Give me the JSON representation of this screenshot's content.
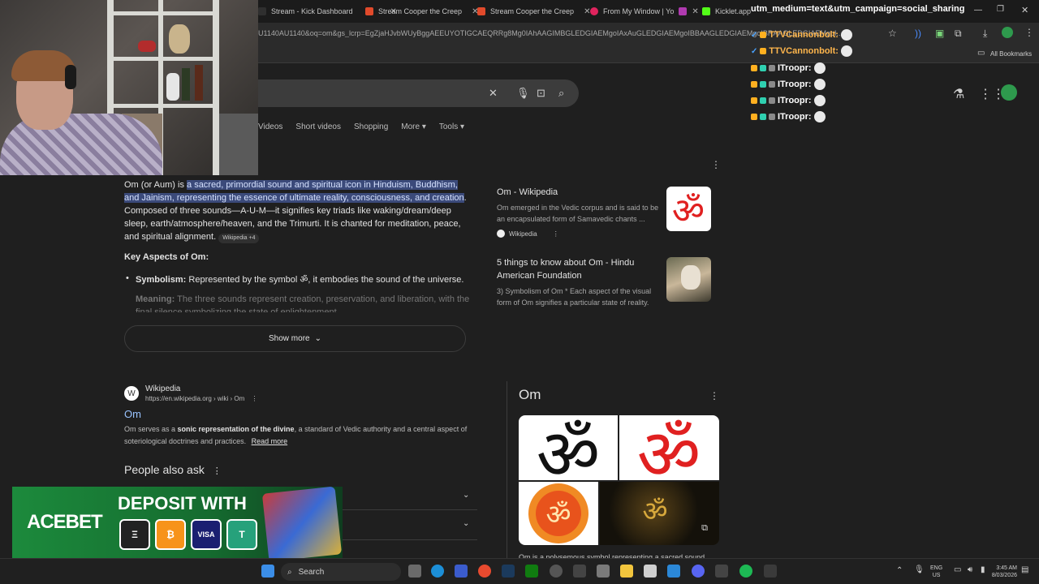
{
  "tabs": [
    {
      "label": "Stream - Kick Dashboard",
      "color": "#2f2f2f"
    },
    {
      "label": "Stream Cooper the Creep",
      "color": "#e14a2b"
    },
    {
      "label": "Stream Cooper the Creep",
      "color": "#e14a2b"
    },
    {
      "label": "From My Window | Yo",
      "color": "#e0245e"
    },
    {
      "label": "Kicklet.app",
      "color": "#53fc18"
    }
  ],
  "address": {
    "url": "U1140AU1140&oq=om&gs_lcrp=EgZjaHJvbWUyBggAEEUYOTIGCAEQRRg8Mg0IAhAAGIMBGLEDGIAEMgoIAxAuGLEDGIAEMgoIBBAAGLEDGIAEMgoIBRAAGLEDGIAEMgoI..."
  },
  "bookmarks": {
    "all_label": "All Bookmarks"
  },
  "search": {
    "filters": [
      "Videos",
      "Short videos",
      "Shopping",
      "More",
      "Tools"
    ]
  },
  "overview": {
    "intro_plain": "Om (or Aum) is ",
    "intro_highlight": "a sacred, primordial sound and spiritual icon in Hinduism, Buddhism, and Jainism, representing the essence of ultimate reality, consciousness, and creation",
    "intro_rest": ". Composed of three sounds—A-U-M—it signifies key triads like waking/dream/deep sleep, earth/atmosphere/heaven, and the Trimurti. It is chanted for meditation, peace, and spiritual alignment.",
    "chip": "Wikipedia +4",
    "key_heading": "Key Aspects of Om:",
    "bullet1_bold": "Symbolism:",
    "bullet1_text": " Represented by the symbol ॐ, it embodies the sound of the universe.",
    "bullet2_bold": "Meaning:",
    "bullet2_text": " The three sounds represent creation, preservation, and liberation, with the final silence symbolizing the state of enlightenment.",
    "show_more": "Show more"
  },
  "sources": [
    {
      "title": "Om - Wikipedia",
      "desc": "Om emerged in the Vedic corpus and is said to be an encapsulated form of Samavedic chants ...",
      "site": "Wikipedia"
    },
    {
      "title": "5 things to know about Om - Hindu American Foundation",
      "desc": "3) Symbolism of Om * Each aspect of the visual form of Om signifies a particular state of reality."
    }
  ],
  "result": {
    "site": "Wikipedia",
    "url": "https://en.wikipedia.org › wiki › Om",
    "title": "Om",
    "snippet_a": "Om serves as a ",
    "snippet_bold": "sonic representation of the divine",
    "snippet_b": ", a standard of Vedic authority and a central aspect of soteriological doctrines and practices.",
    "read_more": "Read more"
  },
  "paa": {
    "heading": "People also ask"
  },
  "knowledge_panel": {
    "title": "Om",
    "text": "Om is a polysemous symbol representing a sacred sound"
  },
  "chat": {
    "top_text": "utm_medium=text&utm_campaign=social_sharing",
    "lines": [
      {
        "name": "TTVCannonbolt:"
      },
      {
        "name": "TTVCannonbolt:"
      },
      {
        "name": "ITroopr:"
      },
      {
        "name": "ITroopr:"
      },
      {
        "name": "ITroopr:"
      },
      {
        "name": "ITroopr:"
      }
    ]
  },
  "ad": {
    "brand": "ACEBET",
    "headline": "DEPOSIT WITH",
    "coins": [
      "Ξ",
      "₿",
      "VISA",
      "T"
    ]
  },
  "taskbar": {
    "search_label": "Search",
    "lang_top": "ENG",
    "lang_bottom": "US",
    "time": "3:45 AM",
    "date": "8/03/2026"
  }
}
